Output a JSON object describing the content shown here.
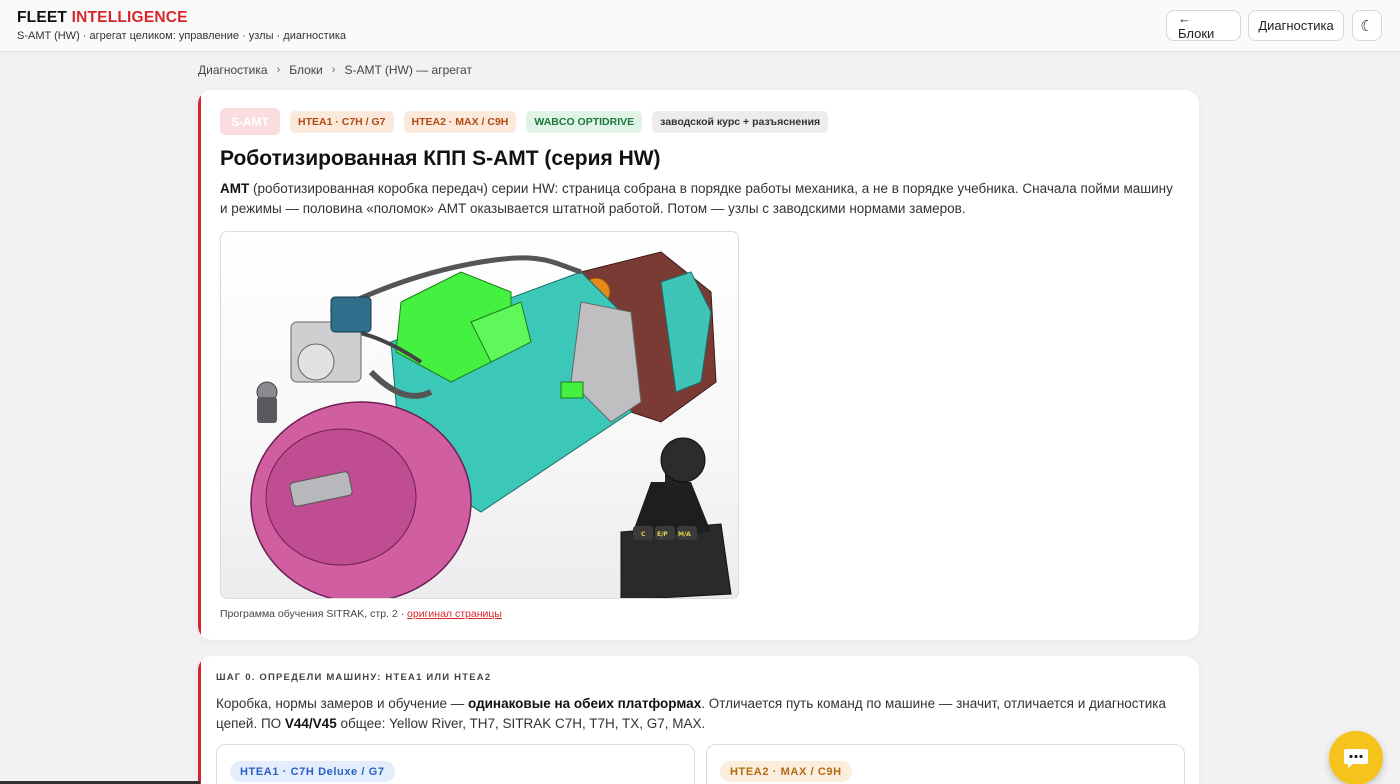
{
  "header": {
    "brand_part1": "FLEET",
    "brand_part2": "INTELLIGENCE",
    "subtitle": "S-AMT (HW) · агрегат целиком: управление · узлы · диагностика",
    "back_button": "← Блоки",
    "diag_button": "Диагностика",
    "theme_icon": "moon-icon",
    "theme_glyph": "☾"
  },
  "breadcrumb": {
    "items": [
      "Диагностика",
      "Блоки",
      "S-AMT (HW) — агрегат"
    ],
    "separator": "›"
  },
  "main_card": {
    "tags": [
      "S-AMT",
      "HTEA1 · C7H / G7",
      "HTEA2 · MAX / C9H",
      "WABCO OPTIDRIVE",
      "заводской курс + разъяснения"
    ],
    "title": "Роботизированная КПП S-AMT (серия HW)",
    "desc_bold": "AMT",
    "desc_rest": " (роботизированная коробка передач) серии HW: страница собрана в порядке работы механика, а не в порядке учебника. Сначала пойми машину и режимы — половина «поломок» АМТ оказывается штатной работой. Потом — узлы с заводскими нормами замеров.",
    "caption_text": "Программа обучения SITRAK, стр. 2 · ",
    "caption_link": "оригинал страницы",
    "shifter_buttons": [
      "C",
      "E/P",
      "M/A"
    ]
  },
  "step_card": {
    "heading": "ШАГ 0. ОПРЕДЕЛИ МАШИНУ: HTEA1 ИЛИ HTEA2",
    "text_a": "Коробка, нормы замеров и обучение — ",
    "text_b": "одинаковые на обеих платформах",
    "text_c": ". Отличается путь команд по машине — значит, отличается и диагностика цепей. ПО ",
    "text_d": "V44/V45",
    "text_e": " общее: Yellow River, TH7, SITRAK C7H, T7H, TX, G7, MAX.",
    "platform1": "HTEA1 · C7H Deluxe / G7",
    "platform2": "HTEA2 · MAX / C9H"
  },
  "chat_icon": "chat-bubble-icon",
  "colors": {
    "accent": "#d8262f",
    "chat": "#f6c21c"
  }
}
